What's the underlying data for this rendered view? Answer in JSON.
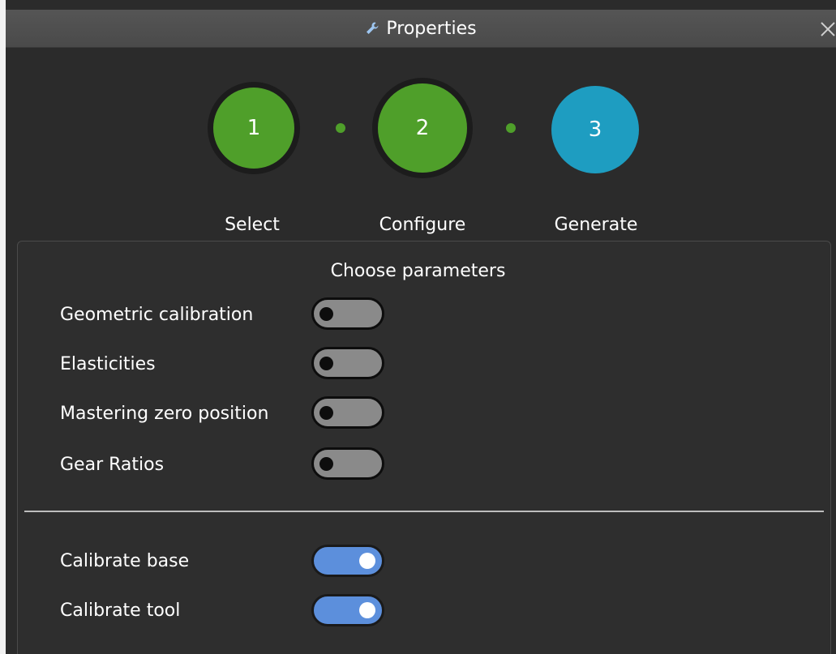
{
  "window": {
    "title": "Properties",
    "title_icon": "wrench-icon",
    "close_icon": "close-icon"
  },
  "wizard": {
    "steps": [
      {
        "number": "1",
        "label": "Select",
        "state": "done",
        "color": "#4f9f2a"
      },
      {
        "number": "2",
        "label": "Configure",
        "state": "current",
        "color": "#4f9f2a"
      },
      {
        "number": "3",
        "label": "Generate",
        "state": "pending",
        "color": "#1e9dc1"
      }
    ]
  },
  "parameters": {
    "title": "Choose parameters",
    "options": [
      {
        "label": "Geometric calibration",
        "enabled": false
      },
      {
        "label": "Elasticities",
        "enabled": false
      },
      {
        "label": "Mastering zero position",
        "enabled": false
      },
      {
        "label": "Gear Ratios",
        "enabled": false
      }
    ],
    "calibration": [
      {
        "label": "Calibrate base",
        "enabled": true
      },
      {
        "label": "Calibrate tool",
        "enabled": true
      }
    ]
  },
  "colors": {
    "background": "#2b2b2b",
    "title_bar": "#4d4d4d",
    "step_done": "#4f9f2a",
    "step_pending": "#1e9dc1",
    "toggle_on": "#5c8fdc",
    "toggle_off": "#8a8a8a"
  }
}
